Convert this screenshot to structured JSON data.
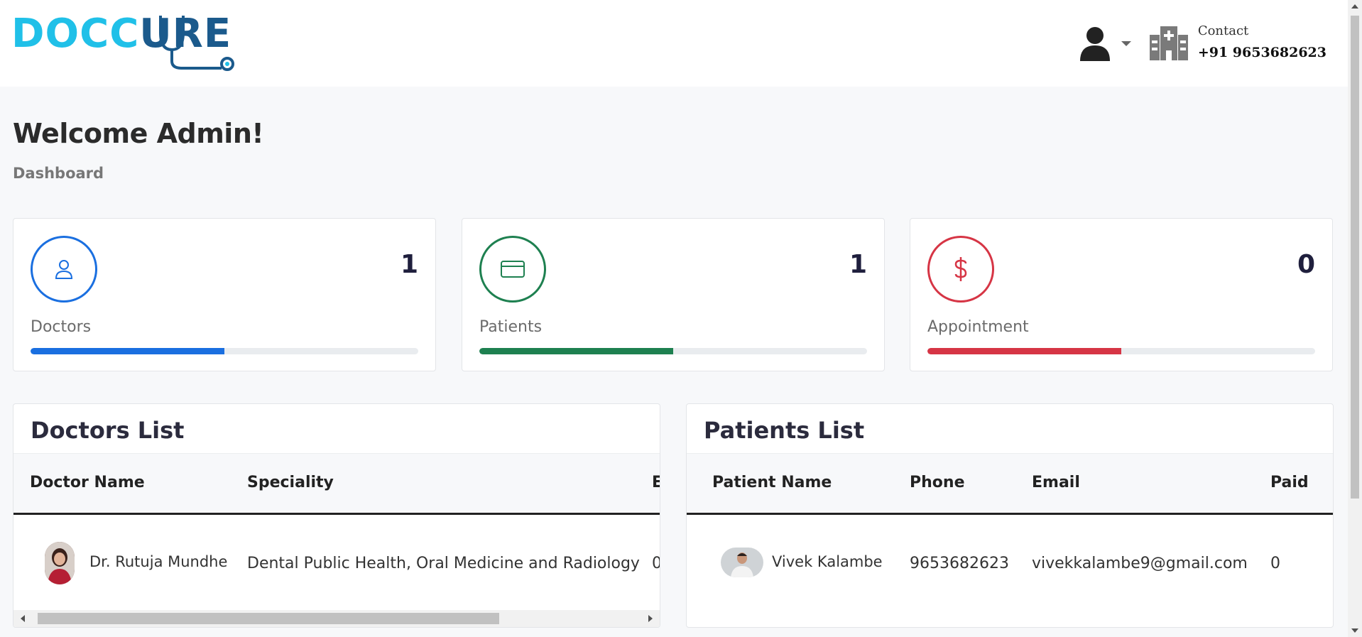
{
  "app": {
    "logo": {
      "part1": "DOCC",
      "part2": "URE"
    }
  },
  "header": {
    "contact_label": "Contact",
    "contact_number": "+91 9653682623"
  },
  "page": {
    "title": "Welcome Admin!",
    "breadcrumb": "Dashboard"
  },
  "stats": [
    {
      "label": "Doctors",
      "count": "1",
      "icon": "user-icon",
      "color": "#1a6fe0",
      "progress_percent": 50
    },
    {
      "label": "Patients",
      "count": "1",
      "icon": "credit-card-icon",
      "color": "#1e8050",
      "progress_percent": 50
    },
    {
      "label": "Appointment",
      "count": "0",
      "icon": "dollar-icon",
      "color": "#d63545",
      "progress_percent": 50
    }
  ],
  "doctors_list": {
    "title": "Doctors List",
    "columns": [
      "Doctor Name",
      "Speciality",
      "E"
    ],
    "rows": [
      {
        "name": "Dr. Rutuja Mundhe",
        "speciality": "Dental Public Health, Oral Medicine and Radiology",
        "partial": "0"
      }
    ]
  },
  "patients_list": {
    "title": "Patients List",
    "columns": [
      "Patient Name",
      "Phone",
      "Email",
      "Paid"
    ],
    "rows": [
      {
        "name": "Vivek Kalambe",
        "phone": "9653682623",
        "email": "vivekkalambe9@gmail.com",
        "paid": "0"
      }
    ]
  }
}
